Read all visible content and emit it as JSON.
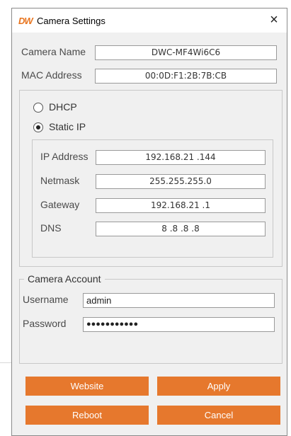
{
  "titlebar": {
    "logo": "DW",
    "title": "Camera Settings",
    "close_glyph": "×"
  },
  "camera": {
    "name_label": "Camera Name",
    "name_value": "DWC-MF4Wi6C6",
    "mac_label": "MAC Address",
    "mac_value": "00:0D:F1:2B:7B:CB"
  },
  "network": {
    "dhcp_label": "DHCP",
    "static_label": "Static IP",
    "selected": "Static IP",
    "ip_label": "IP Address",
    "ip_value": "192.168.21 .144",
    "netmask_label": "Netmask",
    "netmask_value": "255.255.255.0",
    "gateway_label": "Gateway",
    "gateway_value": "192.168.21 .1",
    "dns_label": "DNS",
    "dns_value": "8 .8 .8 .8"
  },
  "account": {
    "legend": "Camera Account",
    "username_label": "Username",
    "username_value": "admin",
    "password_label": "Password",
    "password_value": "●●●●●●●●●●●"
  },
  "buttons": {
    "website": "Website",
    "apply": "Apply",
    "reboot": "Reboot",
    "cancel": "Cancel"
  },
  "colors": {
    "accent": "#e6782d",
    "window_bg": "#f0f0f0"
  }
}
